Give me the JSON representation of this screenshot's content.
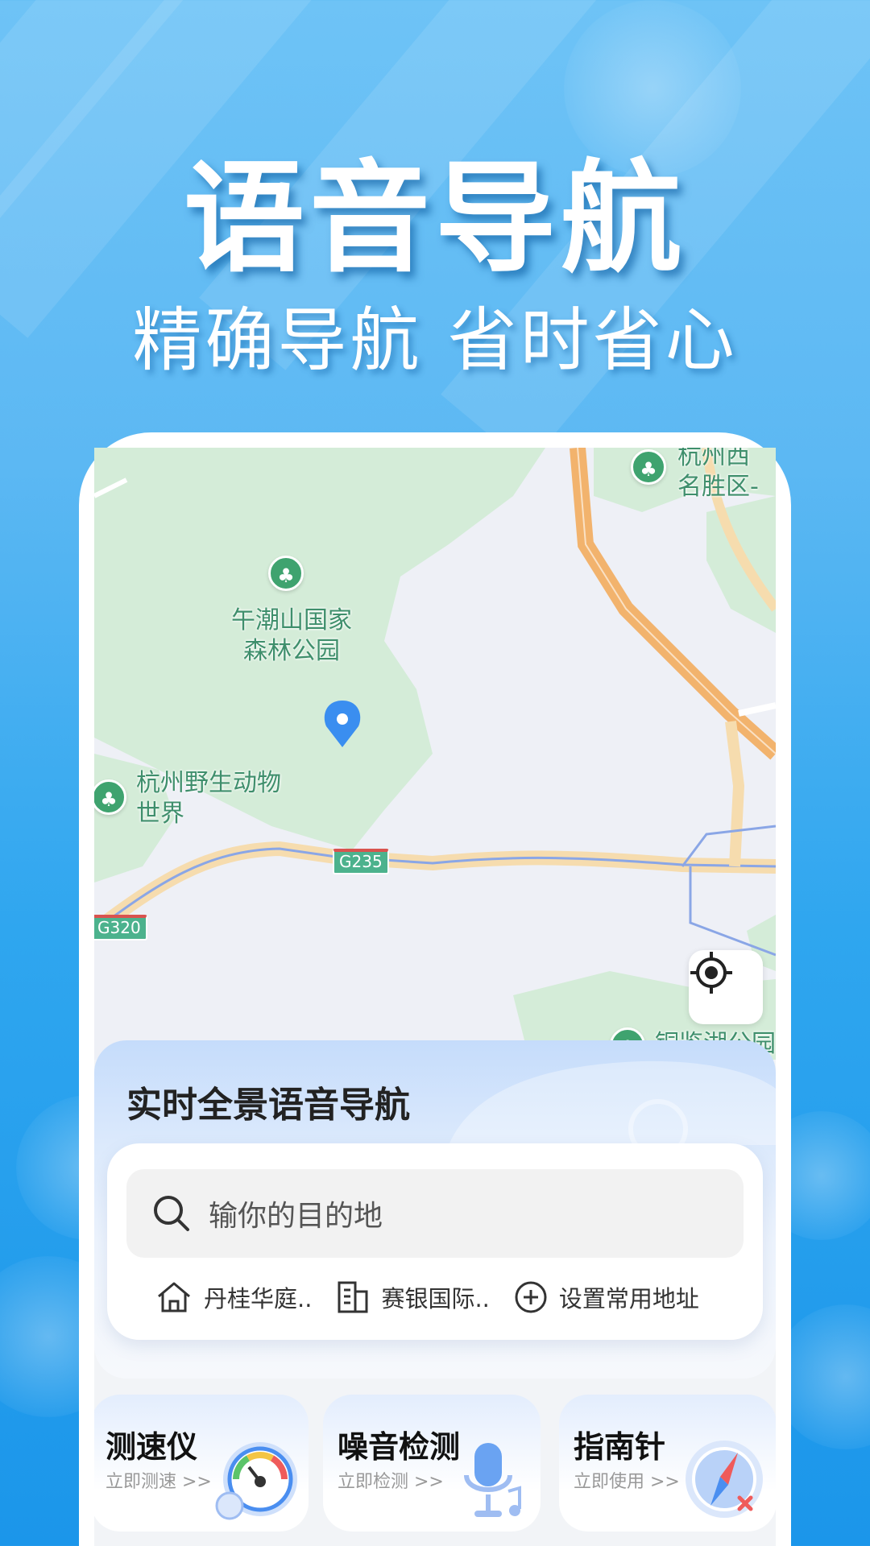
{
  "hero": {
    "title": "语音导航",
    "subtitle": "精确导航 省时省心"
  },
  "map": {
    "labels": [
      {
        "id": "wuchaoshan",
        "text": "午潮山国家\n森林公园"
      },
      {
        "id": "zoo",
        "text": "杭州野生动物\n世界"
      },
      {
        "id": "scenic",
        "text": "杭州西\n名胜区-"
      },
      {
        "id": "lake",
        "text": "铜鉴湖公园"
      }
    ],
    "road_shields": [
      "G235",
      "G320"
    ],
    "locate_icon": "locate-crosshair-icon"
  },
  "nav_panel": {
    "title": "实时全景语音导航",
    "search": {
      "placeholder": "输你的目的地",
      "icon": "search-icon"
    },
    "quick_links": [
      {
        "label": "丹桂华庭..",
        "icon": "home-icon"
      },
      {
        "label": "赛银国际..",
        "icon": "building-icon"
      },
      {
        "label": "设置常用地址",
        "icon": "plus-circle-icon"
      }
    ]
  },
  "tools": [
    {
      "title": "测速仪",
      "sub": "立即测速 >>",
      "icon": "speedometer-icon"
    },
    {
      "title": "噪音检测",
      "sub": "立即检测 >>",
      "icon": "microphone-icon"
    },
    {
      "title": "指南针",
      "sub": "立即使用 >>",
      "icon": "compass-icon"
    }
  ],
  "colors": {
    "accent_blue": "#3a8ef0",
    "park_green": "#3fa36f",
    "highway_orange": "#f0a860"
  }
}
